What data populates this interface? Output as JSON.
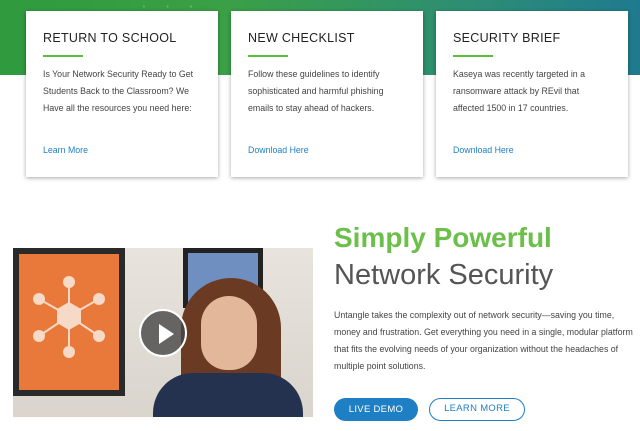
{
  "cards": [
    {
      "title": "RETURN TO SCHOOL",
      "body": "Is Your Network Security Ready to Get Students Back to the Classroom? We Have all the resources you need here:",
      "link": "Learn More"
    },
    {
      "title": "NEW CHECKLIST",
      "body": "Follow these guidelines to identify sophisticated and harmful phishing emails to stay ahead of hackers.",
      "link": "Download Here"
    },
    {
      "title": "SECURITY BRIEF",
      "body": "Kaseya was recently targeted in a ransomware attack by REvil that affected 1500 in 17 countries.",
      "link": "Download Here"
    }
  ],
  "hero": {
    "headline_green": "Simply Powerful",
    "headline_gray": "Network Security",
    "description": "Untangle takes the complexity out of network security—saving you time, money and frustration. Get everything you need in a single, modular platform that fits the evolving needs of your organization without the headaches of multiple point solutions.",
    "btn_demo": "LIVE DEMO",
    "btn_more": "LEARN MORE"
  },
  "colors": {
    "accent_green": "#6cc04a",
    "link_blue": "#1f7fc4"
  },
  "icons": {
    "play": "play-icon"
  }
}
